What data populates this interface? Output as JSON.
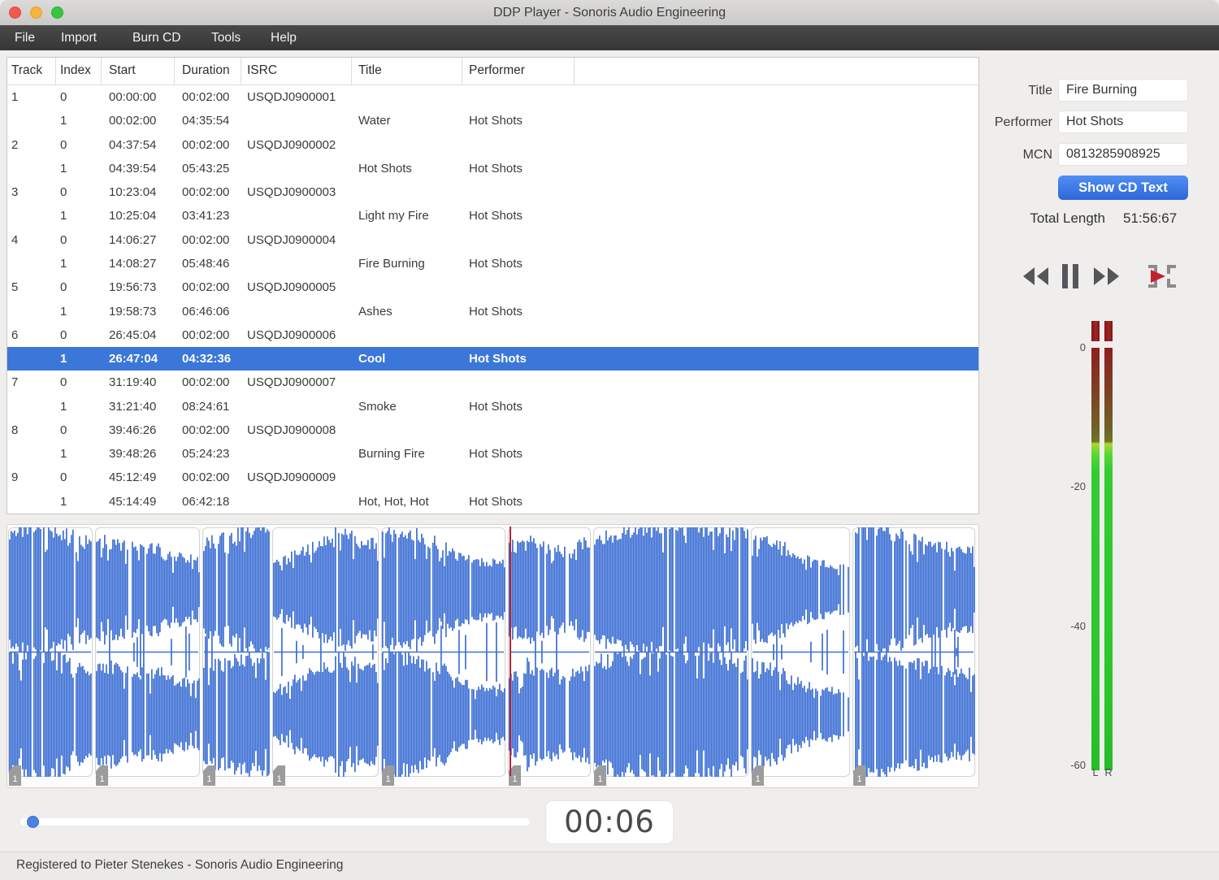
{
  "window": {
    "title": "DDP Player - Sonoris Audio Engineering"
  },
  "menu": {
    "items": [
      "File",
      "Import",
      "Burn CD",
      "Tools",
      "Help"
    ]
  },
  "table": {
    "columns": [
      "Track",
      "Index",
      "Start",
      "Duration",
      "ISRC",
      "Title",
      "Performer"
    ],
    "selected_row_index": 11,
    "rows": [
      {
        "track": "1",
        "index": "0",
        "start": "00:00:00",
        "duration": "00:02:00",
        "isrc": "USQDJ0900001",
        "title": "",
        "performer": ""
      },
      {
        "track": "",
        "index": "1",
        "start": "00:02:00",
        "duration": "04:35:54",
        "isrc": "",
        "title": "Water",
        "performer": "Hot Shots"
      },
      {
        "track": "2",
        "index": "0",
        "start": "04:37:54",
        "duration": "00:02:00",
        "isrc": "USQDJ0900002",
        "title": "",
        "performer": ""
      },
      {
        "track": "",
        "index": "1",
        "start": "04:39:54",
        "duration": "05:43:25",
        "isrc": "",
        "title": "Hot Shots",
        "performer": "Hot Shots"
      },
      {
        "track": "3",
        "index": "0",
        "start": "10:23:04",
        "duration": "00:02:00",
        "isrc": "USQDJ0900003",
        "title": "",
        "performer": ""
      },
      {
        "track": "",
        "index": "1",
        "start": "10:25:04",
        "duration": "03:41:23",
        "isrc": "",
        "title": "Light my Fire",
        "performer": "Hot Shots"
      },
      {
        "track": "4",
        "index": "0",
        "start": "14:06:27",
        "duration": "00:02:00",
        "isrc": "USQDJ0900004",
        "title": "",
        "performer": ""
      },
      {
        "track": "",
        "index": "1",
        "start": "14:08:27",
        "duration": "05:48:46",
        "isrc": "",
        "title": "Fire Burning",
        "performer": "Hot Shots"
      },
      {
        "track": "5",
        "index": "0",
        "start": "19:56:73",
        "duration": "00:02:00",
        "isrc": "USQDJ0900005",
        "title": "",
        "performer": ""
      },
      {
        "track": "",
        "index": "1",
        "start": "19:58:73",
        "duration": "06:46:06",
        "isrc": "",
        "title": "Ashes",
        "performer": "Hot Shots"
      },
      {
        "track": "6",
        "index": "0",
        "start": "26:45:04",
        "duration": "00:02:00",
        "isrc": "USQDJ0900006",
        "title": "",
        "performer": ""
      },
      {
        "track": "",
        "index": "1",
        "start": "26:47:04",
        "duration": "04:32:36",
        "isrc": "",
        "title": "Cool",
        "performer": "Hot Shots"
      },
      {
        "track": "7",
        "index": "0",
        "start": "31:19:40",
        "duration": "00:02:00",
        "isrc": "USQDJ0900007",
        "title": "",
        "performer": ""
      },
      {
        "track": "",
        "index": "1",
        "start": "31:21:40",
        "duration": "08:24:61",
        "isrc": "",
        "title": "Smoke",
        "performer": "Hot Shots"
      },
      {
        "track": "8",
        "index": "0",
        "start": "39:46:26",
        "duration": "00:02:00",
        "isrc": "USQDJ0900008",
        "title": "",
        "performer": ""
      },
      {
        "track": "",
        "index": "1",
        "start": "39:48:26",
        "duration": "05:24:23",
        "isrc": "",
        "title": "Burning Fire",
        "performer": "Hot Shots"
      },
      {
        "track": "9",
        "index": "0",
        "start": "45:12:49",
        "duration": "00:02:00",
        "isrc": "USQDJ0900009",
        "title": "",
        "performer": ""
      },
      {
        "track": "",
        "index": "1",
        "start": "45:14:49",
        "duration": "06:42:18",
        "isrc": "",
        "title": "Hot, Hot, Hot",
        "performer": "Hot Shots"
      }
    ]
  },
  "cd_text": {
    "title_label": "Title",
    "title_value": "Fire Burning",
    "performer_label": "Performer",
    "performer_value": "Hot Shots",
    "mcn_label": "MCN",
    "mcn_value": "0813285908925",
    "show_button": "Show CD Text",
    "total_length_label": "Total Length",
    "total_length_value": "51:56:67"
  },
  "transport": {
    "icons": [
      "rewind",
      "pause",
      "fast-forward",
      "play-from-marker"
    ],
    "time_display": "00:06",
    "slider_value_fraction": 0.025
  },
  "meters": {
    "scale_labels": [
      "0",
      "-20",
      "-40",
      "-60"
    ],
    "channel_labels": [
      "L",
      "R"
    ],
    "level_db": -13.5,
    "clip_indicator_on": true
  },
  "waveform": {
    "marker_label": "1",
    "playhead_fraction": 0.5175,
    "segment_fractions": [
      0,
      0.0897,
      0.2005,
      0.2722,
      0.3847,
      0.5156,
      0.6037,
      0.7662,
      0.8709,
      1.0
    ],
    "color": "#3e70d4",
    "playhead_color": "#b2253e"
  },
  "status_bar": {
    "text": "Registered to Pieter Stenekes - Sonoris Audio Engineering"
  },
  "colors": {
    "selection": "#3b77d9",
    "accent_button": "#3a7be6",
    "menu_bg": "#3f3f3f",
    "meter_green": "#2bc42b",
    "meter_red": "#8d1f1f",
    "waveform_blue": "#3e70d4"
  }
}
